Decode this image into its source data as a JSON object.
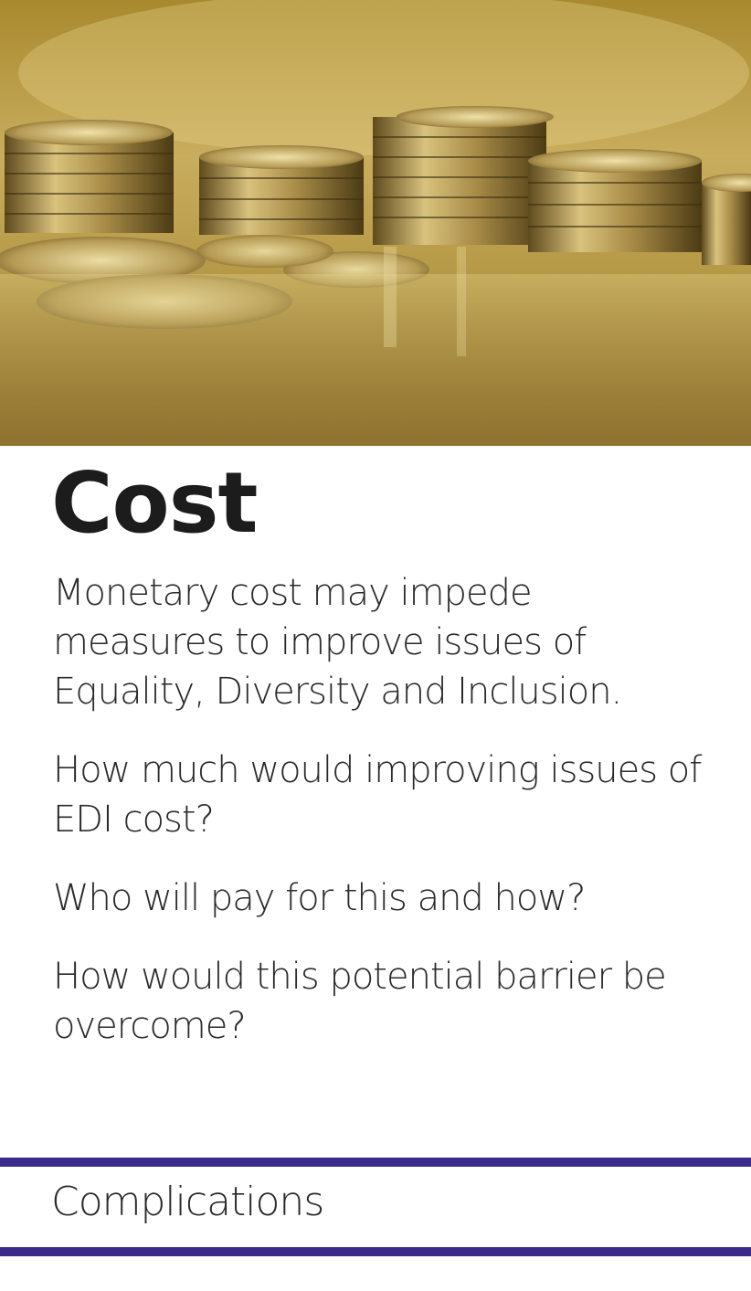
{
  "card": {
    "title": "Cost",
    "paragraphs": [
      "Monetary cost may impede measures to improve issues of Equality, Diversity and Inclusion.",
      "How much would improving issues of EDI cost?",
      "Who will pay for this and how?",
      "How would this potential barrier be overcome?"
    ],
    "category": "Complications"
  },
  "image": {
    "subject": "coins-photo"
  },
  "colors": {
    "accent": "#3a2a8c",
    "title": "#1c1c1c",
    "text": "#2a2a2a"
  }
}
